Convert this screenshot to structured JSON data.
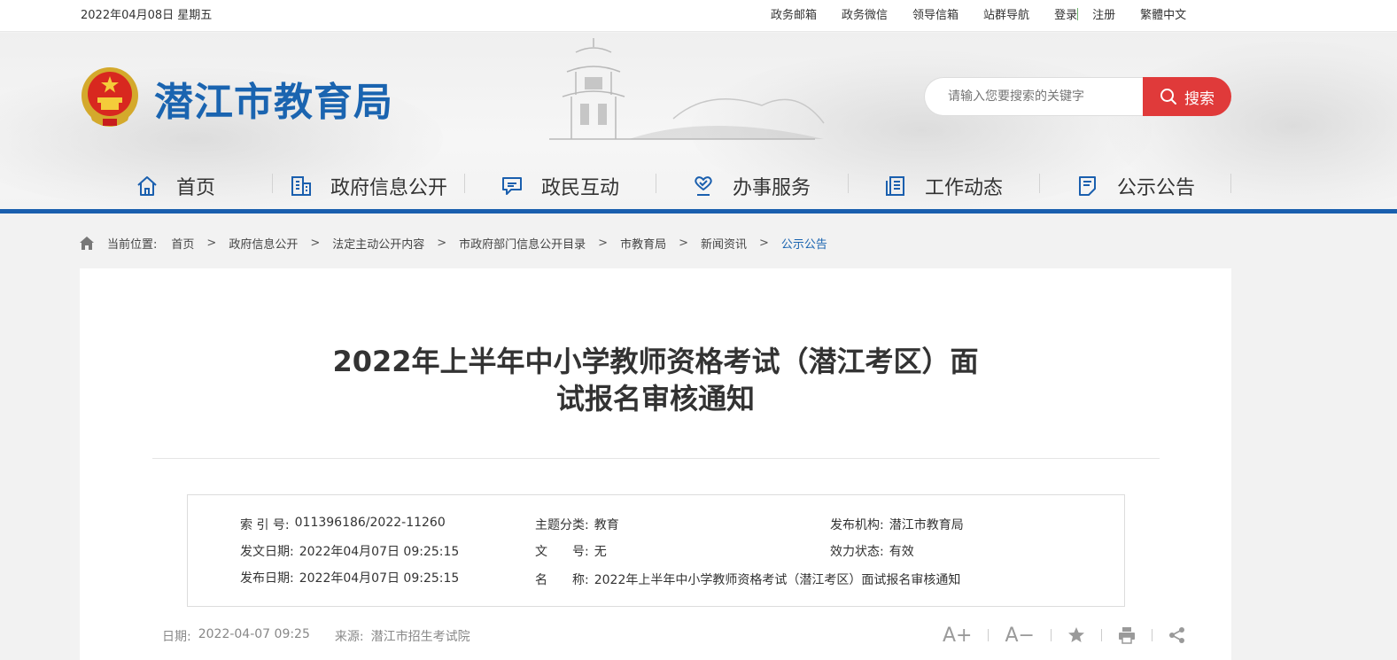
{
  "topbar": {
    "date": "2022年04月08日 星期五",
    "links": [
      "政务邮箱",
      "政务微信",
      "领导信箱",
      "站群导航"
    ],
    "login": "登录",
    "register": "注册",
    "traditional": "繁體中文"
  },
  "header": {
    "site_title": "潜江市教育局",
    "search_placeholder": "请输入您要搜索的关键字",
    "search_button": "搜索"
  },
  "nav": {
    "items": [
      {
        "label": "首页",
        "icon": "home-icon"
      },
      {
        "label": "政府信息公开",
        "icon": "building-icon"
      },
      {
        "label": "政民互动",
        "icon": "chat-icon"
      },
      {
        "label": "办事服务",
        "icon": "heart-hand-icon"
      },
      {
        "label": "工作动态",
        "icon": "document-list-icon"
      },
      {
        "label": "公示公告",
        "icon": "notice-icon"
      }
    ]
  },
  "breadcrumb": {
    "label": "当前位置:",
    "items": [
      "首页",
      "政府信息公开",
      "法定主动公开内容",
      "市政府部门信息公开目录",
      "市教育局",
      "新闻资讯",
      "公示公告"
    ]
  },
  "article": {
    "title": "2022年上半年中小学教师资格考试（潜江考区）面试报名审核通知",
    "meta": {
      "index_label": "索 引 号:",
      "index_value": "011396186/2022-11260",
      "category_label": "主题分类:",
      "category_value": "教育",
      "publisher_label": "发布机构:",
      "publisher_value": "潜江市教育局",
      "issue_date_label": "发文日期:",
      "issue_date_value": "2022年04月07日 09:25:15",
      "doc_no_label": "文　　号:",
      "doc_no_value": "无",
      "status_label": "效力状态:",
      "status_value": "有效",
      "pub_date_label": "发布日期:",
      "pub_date_value": "2022年04月07日 09:25:15",
      "name_label": "名　　称:",
      "name_value": "2022年上半年中小学教师资格考试（潜江考区）面试报名审核通知"
    },
    "date_label": "日期:",
    "date_value": "2022-04-07 09:25",
    "source_label": "来源:",
    "source_value": "潜江市招生考试院",
    "tools": {
      "font_up": "A+",
      "font_down": "A−"
    }
  },
  "colors": {
    "brand_blue": "#1a5fae",
    "search_red": "#e03a3a"
  }
}
